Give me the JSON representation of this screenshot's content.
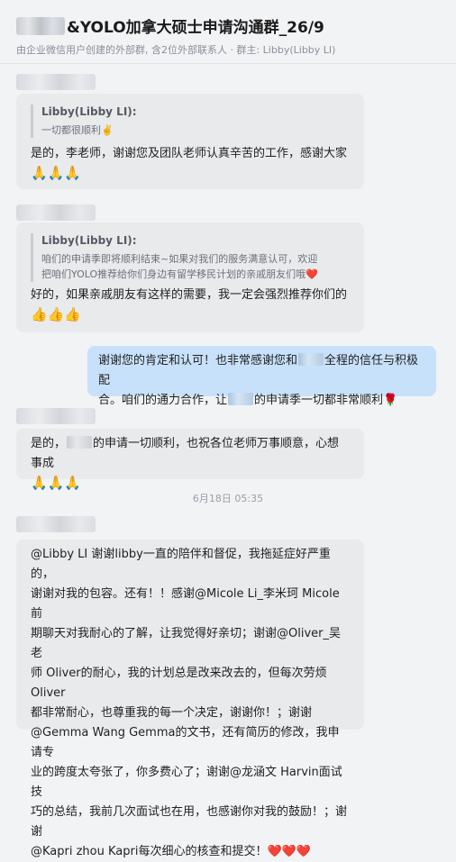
{
  "header": {
    "title": "&YOLO加拿大硕士申请沟通群_26/9",
    "subtitle": "由企业微信用户创建的外部群, 含2位外部联系人 · 群主: Libby(Libby LI)"
  },
  "messages": [
    {
      "quote_author": "Libby(Libby LI):",
      "quote_text": "一切都很顺利✌️",
      "text": "是的，李老师，谢谢您及团队老师认真辛苦的工作，感谢大家",
      "emoji": "🙏🙏🙏"
    },
    {
      "quote_author": "Libby(Libby LI):",
      "quote_text_1": "咱们的申请季即将顺利结束~如果对我们的服务满意认可，欢迎",
      "quote_text_2": "把咱们YOLO推荐给你们身边有留学移民计划的亲戚朋友们哦❤️",
      "text": "好的，如果亲戚朋友有这样的需要，我一定会强烈推荐你们的",
      "emoji": "👍👍👍"
    },
    {
      "line1_a": "谢谢您的肯定和认可！也非常感谢您和",
      "line1_b": "全程的信任与积极配",
      "line2_a": "合。咱们的通力合作，让",
      "line2_b": "的申请季一切都非常顺利🌹"
    },
    {
      "text_a": "是的，",
      "text_b": "的申请一切顺利，也祝各位老师万事顺意，心想事成",
      "emoji": "🙏🙏🙏"
    },
    {
      "lines": [
        "@Libby LI 谢谢libby一直的陪伴和督促，我拖延症好严重的，",
        "谢谢对我的包容。还有！！感谢@Micole Li_李米珂 Micole前",
        "期聊天对我耐心的了解，让我觉得好亲切；谢谢@Oliver_吴老",
        "师 Oliver的耐心，我的计划总是改来改去的，但每次劳烦Oliver",
        "都非常耐心，也尊重我的每一个决定，谢谢你！；谢谢",
        "@Gemma Wang Gemma的文书，还有简历的修改，我申请专",
        "业的跨度太夸张了，你多费心了；谢谢@龙涵文 Harvin面试技",
        "巧的总结，我前几次面试也在用，也感谢你对我的鼓励！；谢谢",
        "@Kapri zhou Kapri每次细心的核查和提交！❤️❤️❤️"
      ]
    }
  ],
  "timestamp": "6月18日 05:35"
}
